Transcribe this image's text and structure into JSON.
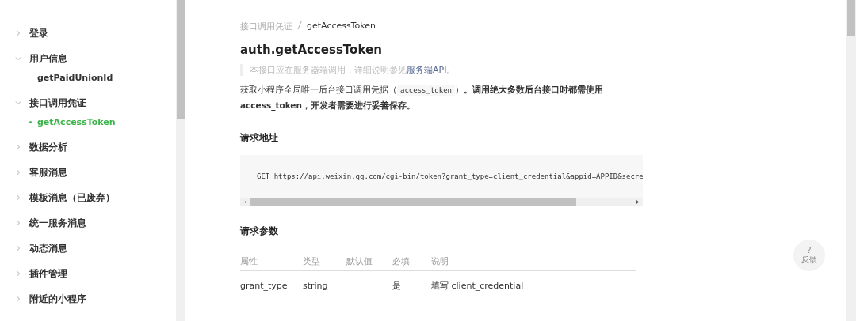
{
  "sidebar": {
    "items": [
      {
        "label": "登录",
        "expanded": false
      },
      {
        "label": "用户信息",
        "expanded": true,
        "children": [
          {
            "label": "getPaidUnionId",
            "selected": false
          }
        ]
      },
      {
        "label": "接口调用凭证",
        "expanded": true,
        "children": [
          {
            "label": "getAccessToken",
            "selected": true
          }
        ]
      },
      {
        "label": "数据分析",
        "expanded": false
      },
      {
        "label": "客服消息",
        "expanded": false
      },
      {
        "label": "模板消息（已废弃）",
        "expanded": false
      },
      {
        "label": "统一服务消息",
        "expanded": false
      },
      {
        "label": "动态消息",
        "expanded": false
      },
      {
        "label": "插件管理",
        "expanded": false
      },
      {
        "label": "附近的小程序",
        "expanded": false
      }
    ]
  },
  "breadcrumb": [
    "接口调用凭证",
    "getAccessToken"
  ],
  "title": "auth.getAccessToken",
  "note": {
    "text": "本接口应在服务器端调用，详细说明参见",
    "link": "服务端API",
    "after": "。"
  },
  "intro": [
    {
      "kind": "text",
      "text": "获取小程序全局唯一后台接口调用凭据（"
    },
    {
      "kind": "code",
      "text": "access_token"
    },
    {
      "kind": "text",
      "text": "）"
    },
    {
      "kind": "bold",
      "text": "。调用绝大多数后台接口时都需使用 access_token，开发者需要进行妥善保存。"
    }
  ],
  "request_url": {
    "heading": "请求地址",
    "code": "GET https://api.weixin.qq.com/cgi-bin/token?grant_type=client_credential&appid=APPID&secre"
  },
  "params": {
    "heading": "请求参数",
    "columns": [
      "属性",
      "类型",
      "默认值",
      "必填",
      "说明"
    ],
    "rows": [
      [
        "grant_type",
        "string",
        "",
        "是",
        "填写 client_credential"
      ]
    ]
  },
  "feedback": {
    "icon": "?",
    "label": "反馈"
  }
}
